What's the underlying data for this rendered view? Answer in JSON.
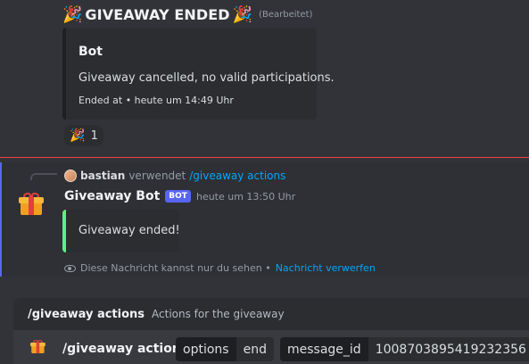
{
  "message1": {
    "emoji": "🎉",
    "title": "GIVEAWAY ENDED",
    "edited": "(Bearbeitet)",
    "embed": {
      "title": "Bot",
      "description": "Giveaway cancelled, no valid participations.",
      "footer": "Ended at • heute um 14:49 Uhr"
    },
    "reaction": {
      "emoji": "🎉",
      "count": "1"
    }
  },
  "message2": {
    "reply": {
      "user": "bastian",
      "action": "verwendet",
      "command": "/giveaway actions"
    },
    "author": "Giveaway Bot",
    "bot_tag": "BOT",
    "timestamp": "heute um 13:50 Uhr",
    "embed_text": "Giveaway ended!",
    "ephemeral_note": "Diese Nachricht kannst nur du sehen •",
    "dismiss_link": "Nachricht verwerfen"
  },
  "command_panel": {
    "name": "/giveaway actions",
    "description": "Actions for the giveaway"
  },
  "input": {
    "command": "/giveaway actions",
    "options": [
      {
        "key": "options",
        "value": "end"
      },
      {
        "key": "message_id",
        "value": "1008703895419232356"
      }
    ]
  },
  "colors": {
    "background": "#313338",
    "embed_bg": "#2b2d31",
    "success_bar": "#57f287",
    "divider": "#f23f42",
    "link": "#00a8fc",
    "bot_tag": "#5865f2"
  }
}
